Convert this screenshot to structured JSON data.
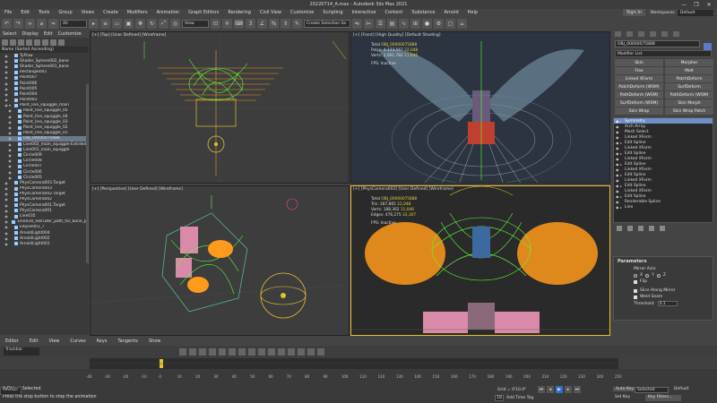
{
  "window": {
    "title": "20220714_A.max - Autodesk 3ds Max 2021",
    "controls": [
      "—",
      "❐",
      "✕"
    ]
  },
  "menu": [
    "File",
    "Edit",
    "Tools",
    "Group",
    "Views",
    "Create",
    "Modifiers",
    "Animation",
    "Graph Editors",
    "Rendering",
    "Civil View",
    "Customize",
    "Scripting",
    "Interactive",
    "Content",
    "Substance",
    "Arnold",
    "Help"
  ],
  "account": {
    "sign_in": "Sign In",
    "workspaces_label": "Workspaces:",
    "workspace": "Default"
  },
  "toolbar": {
    "filter": "All",
    "ref_coord": "View",
    "selection_set": "Create Selection Se"
  },
  "scene_explorer": {
    "tabs": [
      "Select",
      "Display",
      "Edit",
      "Customize"
    ],
    "header": "Name (Sorted Ascending)",
    "items": [
      {
        "name": "TyFlow",
        "depth": 1,
        "expand": ""
      },
      {
        "name": "Shader_Sphere002_bone",
        "depth": 1,
        "expand": ""
      },
      {
        "name": "Shader_Sphere001_bone",
        "depth": 1,
        "expand": ""
      },
      {
        "name": "Rectangle001",
        "depth": 1,
        "expand": ""
      },
      {
        "name": "Point007",
        "depth": 1,
        "expand": ""
      },
      {
        "name": "Point006",
        "depth": 1,
        "expand": ""
      },
      {
        "name": "Point005",
        "depth": 1,
        "expand": ""
      },
      {
        "name": "Point004",
        "depth": 1,
        "expand": ""
      },
      {
        "name": "Point003",
        "depth": 1,
        "expand": ""
      },
      {
        "name": "Point_line_squiggle_main",
        "depth": 1,
        "expand": "▾"
      },
      {
        "name": "Point_line_squiggle_05",
        "depth": 2,
        "expand": ""
      },
      {
        "name": "Point_line_squiggle_04",
        "depth": 2,
        "expand": ""
      },
      {
        "name": "Point_line_squiggle_03",
        "depth": 2,
        "expand": ""
      },
      {
        "name": "Point_line_squiggle_02",
        "depth": 2,
        "expand": ""
      },
      {
        "name": "Point_line_squiggle_01",
        "depth": 2,
        "expand": ""
      },
      {
        "name": "OBJ_00000075888",
        "depth": 2,
        "expand": "",
        "selected": true
      },
      {
        "name": "Line002_main_squiggle-Extrded",
        "depth": 2,
        "expand": ""
      },
      {
        "name": "Line001_main_squiggle",
        "depth": 2,
        "expand": ""
      },
      {
        "name": "Circle009",
        "depth": 2,
        "expand": ""
      },
      {
        "name": "Circle008",
        "depth": 2,
        "expand": ""
      },
      {
        "name": "Circle007",
        "depth": 2,
        "expand": ""
      },
      {
        "name": "Circle006",
        "depth": 2,
        "expand": ""
      },
      {
        "name": "Circle005",
        "depth": 2,
        "expand": ""
      },
      {
        "name": "PhysCamera003.Target",
        "depth": 1,
        "expand": ""
      },
      {
        "name": "PhysCamera003",
        "depth": 1,
        "expand": ""
      },
      {
        "name": "PhysCamera002.Target",
        "depth": 1,
        "expand": ""
      },
      {
        "name": "PhysCamera002",
        "depth": 1,
        "expand": ""
      },
      {
        "name": "PhysCamera001.Target",
        "depth": 1,
        "expand": ""
      },
      {
        "name": "PhysCamera001",
        "depth": 1,
        "expand": ""
      },
      {
        "name": "Line035",
        "depth": 1,
        "expand": ""
      },
      {
        "name": "Line034_extruder_path_for_bone_pc",
        "depth": 1,
        "expand": ""
      },
      {
        "name": "Ellipse001_T",
        "depth": 1,
        "expand": ""
      },
      {
        "name": "ArnoldLight004",
        "depth": 1,
        "expand": ""
      },
      {
        "name": "ArnoldLight002",
        "depth": 1,
        "expand": ""
      },
      {
        "name": "ArnoldLight001",
        "depth": 1,
        "expand": ""
      }
    ]
  },
  "viewports": {
    "top": {
      "label": "[+] [Top] [User Defined] [Wireframe]"
    },
    "front": {
      "label": "[+] [Front] [High Quality] [Default Shading]",
      "stats": {
        "total": "Total",
        "name": "OBJ_00000075888",
        "polys_label": "Polys:",
        "polys": "4,123,567",
        "polys2": "22,048",
        "verts_label": "Verts:",
        "verts": "2,061,782",
        "verts2": "11,046",
        "fps_label": "FPS:",
        "fps": "Inactive"
      }
    },
    "perspective": {
      "label": "[+] [Perspective] [User Defined] [Wireframe]"
    },
    "camera": {
      "label": "[+] [PhysCamera003] [User Defined] [Wireframe]",
      "stats": {
        "total": "Total",
        "name": "OBJ_00000075888",
        "tris_label": "Tris:",
        "tris": "287,865",
        "tris2": "22,048",
        "verts_label": "Verts:",
        "verts": "188,362",
        "verts2": "11,046",
        "edges_label": "Edges:",
        "edges": "476,275",
        "edges2": "33,167",
        "fps_label": "FPS:",
        "fps": "Inactive"
      }
    }
  },
  "command_panel": {
    "object_name": "OBJ_00000075888",
    "modifier_list": "Modifier List",
    "buttons": [
      "Skin",
      "Morpher",
      "Flex",
      "Melt",
      "Linked XForm",
      "PatchDeform",
      "PatchDeform (WSM)",
      "SurfDeform",
      "PathDeform (WSM)",
      "PathDeform (WSM)",
      "SurfDeform (WSM)",
      "Skin Morph",
      "Skin Wrap",
      "Skin Wrap Patch"
    ],
    "stack": [
      {
        "name": "Symmetry",
        "selected": true,
        "expand": "▸"
      },
      {
        "name": "Arch Array",
        "selected": false,
        "expand": ""
      },
      {
        "name": "Mesh Select",
        "selected": false,
        "expand": ""
      },
      {
        "name": "Linked XForm",
        "selected": false,
        "expand": ""
      },
      {
        "name": "Edit Spline",
        "selected": false,
        "expand": "▸"
      },
      {
        "name": "Linked XForm",
        "selected": false,
        "expand": ""
      },
      {
        "name": "Edit Spline",
        "selected": false,
        "expand": "▸"
      },
      {
        "name": "Linked XForm",
        "selected": false,
        "expand": ""
      },
      {
        "name": "Edit Spline",
        "selected": false,
        "expand": "▸"
      },
      {
        "name": "Linked XForm",
        "selected": false,
        "expand": ""
      },
      {
        "name": "Edit Spline",
        "selected": false,
        "expand": "▸"
      },
      {
        "name": "Linked XForm",
        "selected": false,
        "expand": ""
      },
      {
        "name": "Edit Spline",
        "selected": false,
        "expand": "▸"
      },
      {
        "name": "Linked XForm",
        "selected": false,
        "expand": ""
      },
      {
        "name": "Edit Spline",
        "selected": false,
        "expand": "▸"
      },
      {
        "name": "Renderable Spline",
        "selected": false,
        "expand": ""
      },
      {
        "name": "Line",
        "selected": false,
        "expand": "▸"
      }
    ],
    "params": {
      "title": "Parameters",
      "mirror_axis": "Mirror Axis:",
      "x": "X",
      "y": "Y",
      "z": "Z",
      "flip": "Flip",
      "slice": "Slice Along Mirror",
      "weld": "Weld Seam",
      "threshold_label": "Threshold:",
      "threshold": "0.1"
    }
  },
  "bottom": {
    "menu": [
      "Editor",
      "Edit",
      "View",
      "Curves",
      "Keys",
      "Tangents",
      "Show"
    ],
    "track_label": "Trackbar",
    "ticks": [
      "-40",
      "-30",
      "-20",
      "-10",
      "0",
      "10",
      "20",
      "30",
      "40",
      "50",
      "60",
      "70",
      "80",
      "90",
      "100",
      "110",
      "120",
      "130",
      "140",
      "150",
      "160",
      "170",
      "180",
      "190",
      "200",
      "210",
      "220",
      "230",
      "240",
      "250"
    ],
    "status_selected": "1 Object Selected",
    "status_hint": "Press the stop button to stop the animation",
    "grid": "Grid = 0'10.0\"",
    "add_time_tag": "Add Time Tag",
    "auto_key": "Auto Key",
    "selected": "Selected",
    "set_key": "Set Key",
    "key_filters": "Key Filters...",
    "frame": "18",
    "default_label": "Default",
    "maxscript": "MAXScr"
  },
  "colors": {
    "accent": "#e8c030",
    "selection": "#6c8fc6",
    "wire_green": "#5aff3a",
    "wire_orange": "#ff9a1a"
  }
}
